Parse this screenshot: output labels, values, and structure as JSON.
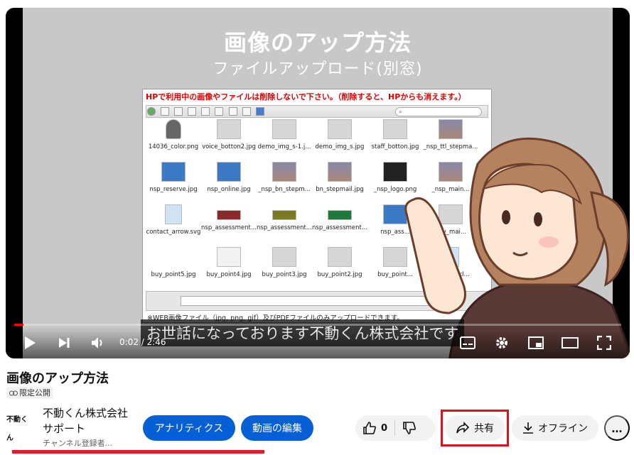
{
  "video": {
    "title_overlay": "画像のアップ方法",
    "subtitle_overlay": "ファイルアップロード(別窓)",
    "caption": "お世話になっております不動くん株式会社です",
    "progress": 0.015
  },
  "screenshot": {
    "warning": "HPで利用中の画像やファイルは削除しないで下さい。（削除すると、HPからも消えます。）",
    "search_icon": "search-icon",
    "note": "※WEB画像ファイル（jpg, png, gif）及びPDFファイルのみアップロードできます。",
    "files": [
      "14036_color.png",
      "voice_botton2.jpg",
      "demo_img_s-1.j...",
      "demo_img_s.jpg",
      "staff_botton.jpg",
      "_nsp_ttl_stepma...",
      "nsp_reserve.jpg",
      "nsp_online.jpg",
      "_nsp_bn_stepm...",
      "bn_stepmail.jpg",
      "_nsp_logo.png",
      "_nsp_main...",
      "contact_arrow.svg",
      "nsp_assessment...",
      "nsp_assessment...",
      "nsp_assessment...",
      "nsp_ass...",
      "buy_mai...",
      "buy_point5.jpg",
      "buy_point4.jpg",
      "buy_point3.jpg",
      "buy_point2.jpg",
      "buy_point...",
      "...g_checkI..."
    ]
  },
  "player": {
    "time": "0:02 / 2:46",
    "icons": [
      "play-icon",
      "next-icon",
      "volume-icon",
      "subtitles-icon",
      "settings-icon",
      "miniplayer-icon",
      "theater-icon",
      "fullscreen-icon"
    ]
  },
  "info": {
    "title": "画像のアップ方法",
    "visibility": "限定公開",
    "channel_avatar": "不動くん",
    "channel_name": "不動くん株式会社サポート",
    "subscribers": "チャンネル登録者...",
    "analytics_label": "アナリティクス",
    "edit_label": "動画の編集",
    "like_count": "0",
    "share_label": "共有",
    "offline_label": "オフライン",
    "more_label": "..."
  }
}
